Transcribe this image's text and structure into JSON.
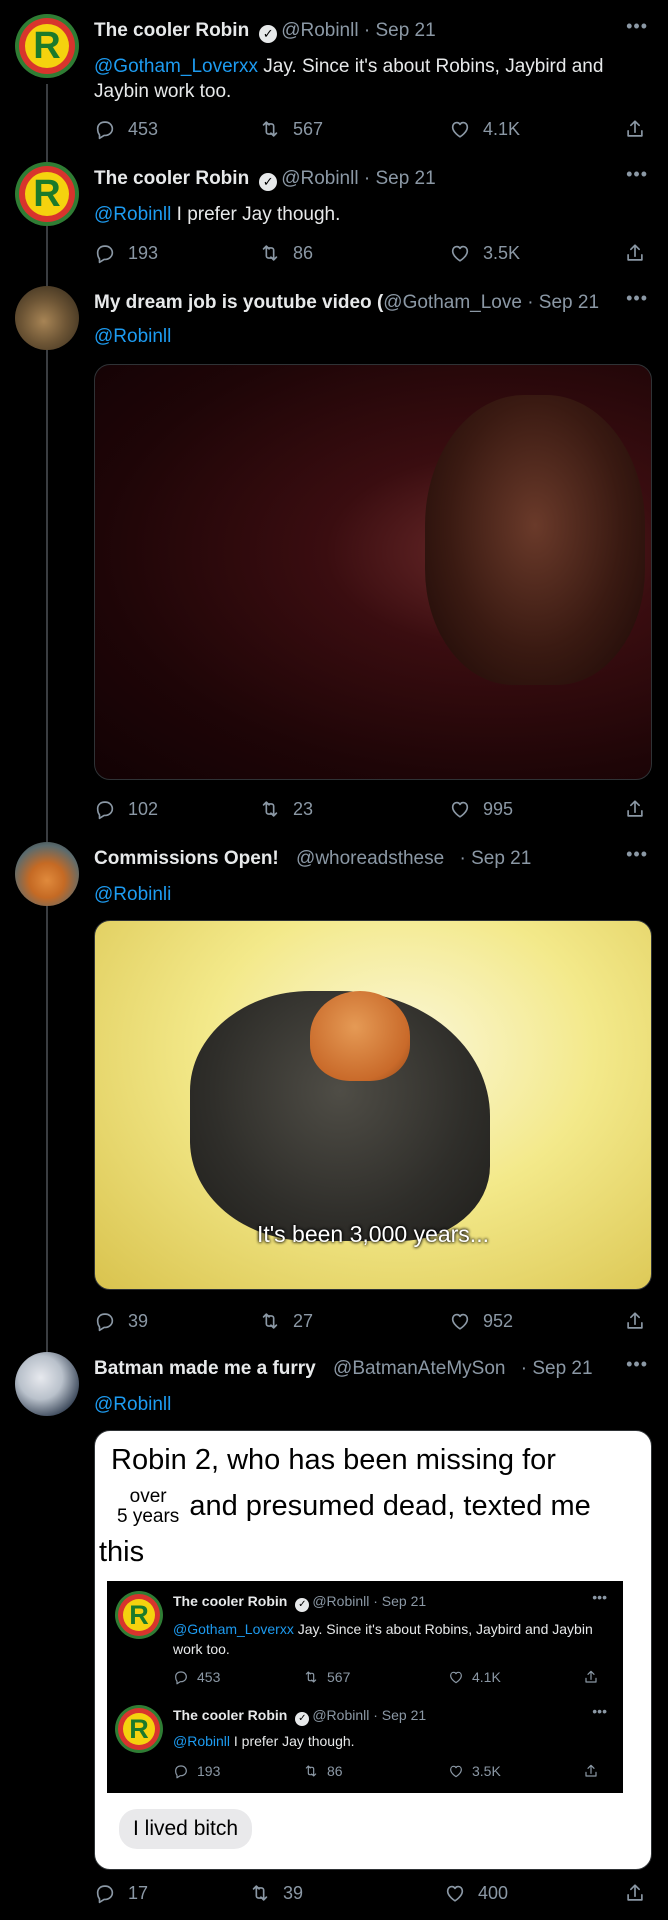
{
  "tweets": [
    {
      "name": "The cooler Robin",
      "handle": "@Robinll",
      "date": "· Sep 21",
      "mention": "@Gotham_Loverxx",
      "text": " Jay. Since it's about Robins, Jaybird and Jaybin work too.",
      "replies": "453",
      "retweets": "567",
      "likes": "4.1K",
      "more": "•••"
    },
    {
      "name": "The cooler Robin",
      "handle": "@Robinll",
      "date": "· Sep 21",
      "mention": "@Robinll",
      "text": " I prefer Jay though.",
      "replies": "193",
      "retweets": "86",
      "likes": "3.5K",
      "more": "•••"
    },
    {
      "name": "My dream job is youtube video (",
      "handle": "@Gotham_Love",
      "date": "· Sep 21",
      "mention": "@Robinll",
      "replies": "102",
      "retweets": "23",
      "likes": "995",
      "more": "•••"
    },
    {
      "name": "Commissions Open!",
      "handle": "@whoreadsthese",
      "date": "· Sep 21",
      "mention": "@Robinli",
      "media_caption": "It's been 3,000 years...",
      "replies": "39",
      "retweets": "27",
      "likes": "952",
      "more": "•••"
    },
    {
      "name": "Batman made me a furry",
      "handle": "@BatmanAteMySon",
      "date": "· Sep 21",
      "mention": "@Robinll",
      "replies": "17",
      "retweets": "39",
      "likes": "400",
      "more": "•••"
    }
  ],
  "meme": {
    "line1_a": "Robin 2",
    "line1_b": ", who has been  missing for",
    "over": "over",
    "years": "5 years",
    "line2": "and presumed dead, texted me",
    "line3": "this",
    "bubble": "I lived bitch"
  },
  "embedded": [
    {
      "name": "The cooler Robin",
      "handle": "@Robinll",
      "date": "· Sep 21",
      "mention": "@Gotham_Loverxx",
      "text": " Jay. Since it's about Robins, Jaybird and Jaybin work too.",
      "replies": "453",
      "retweets": "567",
      "likes": "4.1K"
    },
    {
      "name": "The cooler Robin",
      "handle": "@Robinll",
      "date": "· Sep 21",
      "mention": "@Robinll",
      "text": " I prefer Jay though.",
      "replies": "193",
      "retweets": "86",
      "likes": "3.5K"
    }
  ],
  "avatar_letter": "R",
  "colors": {
    "background": "#000000",
    "text": "#e7e9ea",
    "muted": "#8b98a5",
    "link": "#1d9bf0",
    "thread_line": "#3a3d41"
  },
  "icons": [
    "reply-icon",
    "retweet-icon",
    "like-icon",
    "share-icon",
    "verified-badge-icon",
    "more-icon"
  ]
}
